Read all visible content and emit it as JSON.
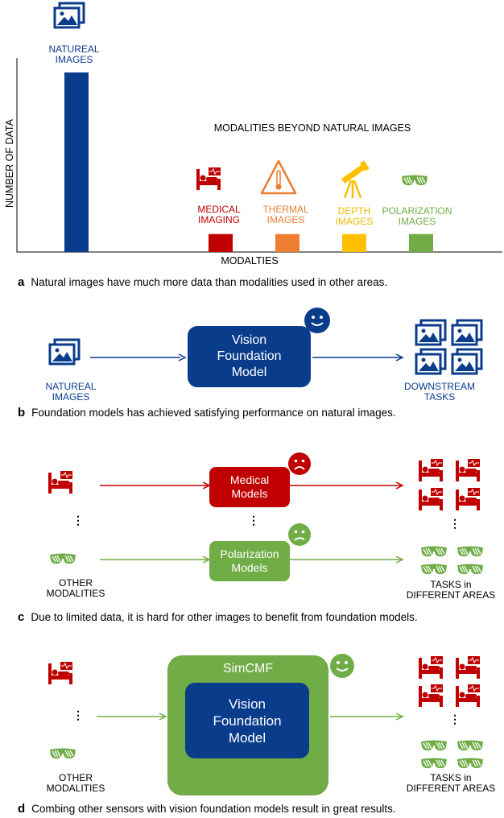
{
  "colors": {
    "blue": "#0a3c8c",
    "red": "#c00000",
    "orange": "#ed7d31",
    "yellow": "#ffc000",
    "green": "#70ad47",
    "black": "#000000"
  },
  "panel_a": {
    "caption_letter": "a",
    "caption_text": "Natural images have much more data than modalities used in other areas.",
    "beyond_label": "MODALITIES BEYOND NATURAL IMAGES",
    "natural_label_1": "NATUREAL",
    "natural_label_2": "IMAGES",
    "medical_label_1": "MEDICAL",
    "medical_label_2": "IMAGING",
    "thermal_label_1": "THERMAL",
    "thermal_label_2": "IMAGES",
    "depth_label_1": "DEPTH",
    "depth_label_2": "IMAGES",
    "polar_label_1": "POLARIZATION",
    "polar_label_2": "IMAGES",
    "icons": [
      "image-icon",
      "hospital-bed-icon",
      "thermometer-warning-icon",
      "telescope-icon",
      "sunglasses-icon"
    ]
  },
  "chart_data": {
    "type": "bar",
    "title": "",
    "xlabel": "MODALTIES",
    "ylabel": "NUMBER OF DATA",
    "categories": [
      "NATUREAL IMAGES",
      "MEDICAL IMAGING",
      "THERMAL IMAGES",
      "DEPTH IMAGES",
      "POLARIZATION IMAGES"
    ],
    "values": [
      100,
      10,
      10,
      10,
      10
    ],
    "colors": [
      "#0a3c8c",
      "#c00000",
      "#ed7d31",
      "#ffc000",
      "#70ad47"
    ],
    "ylim": [
      0,
      100
    ],
    "grid": false,
    "legend": "none",
    "annotation": "MODALITIES BEYOND NATURAL IMAGES"
  },
  "panel_b": {
    "caption_letter": "b",
    "caption_text": "Foundation models has achieved satisfying performance on natural images.",
    "input_label_1": "NATUREAL",
    "input_label_2": "IMAGES",
    "model_line_1": "Vision",
    "model_line_2": "Foundation",
    "model_line_3": "Model",
    "output_label_1": "DOWNSTREAM",
    "output_label_2": "TASKS",
    "emoji": "happy-face-icon"
  },
  "panel_c": {
    "caption_letter": "c",
    "caption_text": "Due to limited data, it is hard for other images to benefit from foundation models.",
    "medical_model_1": "Medical",
    "medical_model_2": "Models",
    "polar_model_1": "Polarization",
    "polar_model_2": "Models",
    "input_label_1": "OTHER",
    "input_label_2": "MODALITIES",
    "output_label_1": "TASKS in",
    "output_label_2": "DIFFERENT AREAS",
    "ellipsis": "⋮",
    "emoji_medical": "sad-face-icon",
    "emoji_polar": "sad-face-icon"
  },
  "panel_d": {
    "caption_letter": "d",
    "caption_text": "Combing other sensors with vision foundation models result in great results.",
    "outer_title": "SimCMF",
    "model_line_1": "Vision",
    "model_line_2": "Foundation",
    "model_line_3": "Model",
    "input_label_1": "OTHER",
    "input_label_2": "MODALITIES",
    "output_label_1": "TASKS in",
    "output_label_2": "DIFFERENT AREAS",
    "ellipsis": "⋮",
    "emoji": "happy-face-icon"
  }
}
